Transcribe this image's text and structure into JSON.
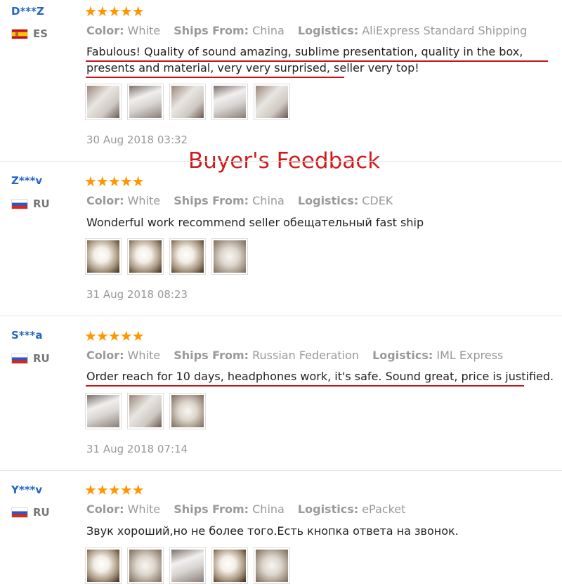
{
  "banner": "Buyer's Feedback",
  "stars": "★★★★★",
  "labels": {
    "color": "Color:",
    "ships": "Ships From:",
    "logistics": "Logistics:"
  },
  "reviews": [
    {
      "user": "D***Z",
      "country": "ES",
      "color": "White",
      "ships_from": "China",
      "logistics": "AliExpress Standard Shipping",
      "text": "Fabulous! Quality of sound amazing, sublime presentation, quality in the box, presents and material, very very surprised, seller very top!",
      "date": "30 Aug 2018 03:32",
      "photos": 5
    },
    {
      "user": "Z***v",
      "country": "RU",
      "color": "White",
      "ships_from": "China",
      "logistics": "CDEK",
      "text": "Wonderful work recommend seller обещательный fast ship",
      "date": "31 Aug 2018 08:23",
      "photos": 4
    },
    {
      "user": "S***a",
      "country": "RU",
      "color": "White",
      "ships_from": "Russian Federation",
      "logistics": "IML Express",
      "text": "Order reach for 10 days, headphones work, it's safe. Sound great, price is justified.",
      "date": "31 Aug 2018 07:14",
      "photos": 3
    },
    {
      "user": "Y***v",
      "country": "RU",
      "color": "White",
      "ships_from": "China",
      "logistics": "ePacket",
      "text": "Звук хороший,но не более того.Есть кнопка ответа на звонок.",
      "date": "",
      "photos": 5
    }
  ],
  "colors": {
    "username": "#2466c4",
    "stars": "#ff9600",
    "banner": "#d11b1b",
    "underline": "#c21616"
  }
}
